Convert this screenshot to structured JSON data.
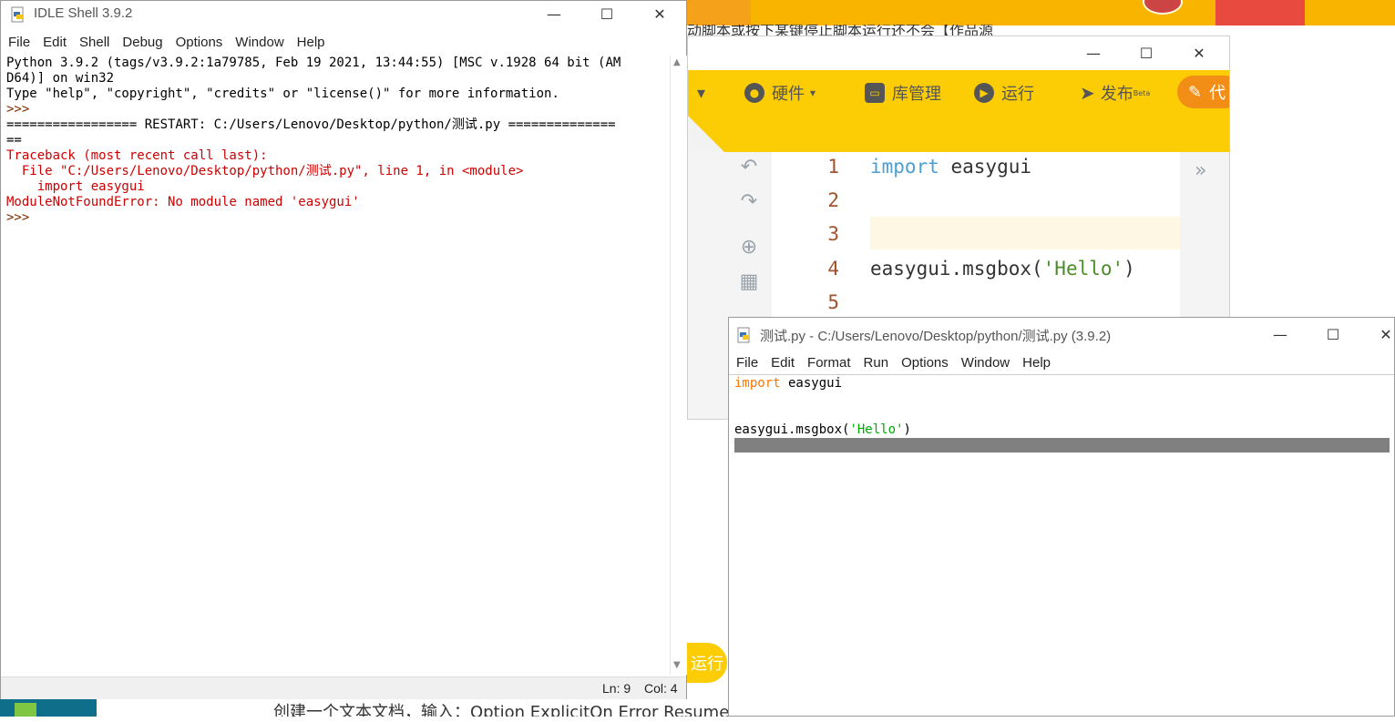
{
  "background": {
    "top_text": "动脚本或按下某键停止脚本运行还不会【作品源",
    "bottom_text": "创建一个文本文档，输入：Option ExplicitOn Error Resume N"
  },
  "mixly": {
    "toolbar": {
      "hardware": "硬件",
      "library": "库管理",
      "run": "运行",
      "publish": "发布",
      "publish_sup": "Beta",
      "code": "代"
    },
    "line_numbers": [
      "1",
      "2",
      "3",
      "4",
      "5"
    ],
    "code": {
      "line1_kw": "import",
      "line1_rest": " easygui",
      "line4_pre": "easygui.msgbox(",
      "line4_str": "'Hello'",
      "line4_post": ")"
    },
    "run_pill": "运行"
  },
  "shell": {
    "title": "IDLE Shell 3.9.2",
    "menu": [
      "File",
      "Edit",
      "Shell",
      "Debug",
      "Options",
      "Window",
      "Help"
    ],
    "lines": {
      "l1": "Python 3.9.2 (tags/v3.9.2:1a79785, Feb 19 2021, 13:44:55) [MSC v.1928 64 bit (AM",
      "l2": "D64)] on win32",
      "l3": "Type \"help\", \"copyright\", \"credits\" or \"license()\" for more information.",
      "l4": ">>> ",
      "l5": "================= RESTART: C:/Users/Lenovo/Desktop/python/测试.py ==============",
      "l6": "==",
      "e1": "Traceback (most recent call last):",
      "e2": "  File \"C:/Users/Lenovo/Desktop/python/测试.py\", line 1, in <module>",
      "e3": "    import easygui",
      "e4": "ModuleNotFoundError: No module named 'easygui'",
      "l7": ">>> "
    },
    "status": {
      "line": "Ln: 9",
      "col": "Col: 4"
    }
  },
  "editor": {
    "title": "测试.py - C:/Users/Lenovo/Desktop/python/测试.py (3.9.2)",
    "menu": [
      "File",
      "Edit",
      "Format",
      "Run",
      "Options",
      "Window",
      "Help"
    ],
    "code": {
      "l1_kw": "import",
      "l1_rest": " easygui",
      "l3_pre": "easygui.msgbox(",
      "l3_str": "'Hello'",
      "l3_post": ")"
    }
  },
  "window_controls": {
    "minimize": "—",
    "maximize": "☐",
    "close": "✕"
  },
  "colors": {
    "mixly_yellow": "#fccc05",
    "error_red": "#cc0000",
    "idle_keyword": "#ff7700",
    "idle_string": "#00aa00"
  }
}
